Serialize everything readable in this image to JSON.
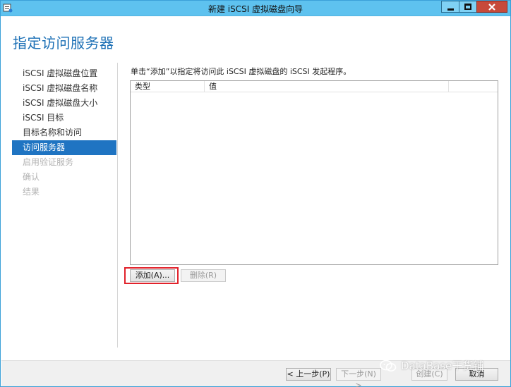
{
  "window": {
    "title": "新建 iSCSI 虚拟磁盘向导",
    "heading": "指定访问服务器"
  },
  "colors": {
    "titlebar": "#5ec2ef",
    "heading": "#1b6fb5",
    "nav_active": "#1f74c2",
    "highlight": "#e1222b"
  },
  "icons": {
    "app": "wizard-app-icon",
    "minimize": "minimize-icon",
    "maximize": "maximize-icon",
    "close": "close-icon",
    "watermark": "wechat-icon"
  },
  "nav": {
    "items": [
      {
        "label": "iSCSI 虚拟磁盘位置",
        "state": "normal"
      },
      {
        "label": "iSCSI 虚拟磁盘名称",
        "state": "normal"
      },
      {
        "label": "iSCSI 虚拟磁盘大小",
        "state": "normal"
      },
      {
        "label": "iSCSI 目标",
        "state": "normal"
      },
      {
        "label": "目标名称和访问",
        "state": "normal"
      },
      {
        "label": "访问服务器",
        "state": "active"
      },
      {
        "label": "启用验证服务",
        "state": "disabled"
      },
      {
        "label": "确认",
        "state": "disabled"
      },
      {
        "label": "结果",
        "state": "disabled"
      }
    ]
  },
  "main": {
    "instruction": "单击“添加”以指定将访问此 iSCSI 虚拟磁盘的 iSCSI 发起程序。",
    "columns": [
      "类型",
      "值",
      ""
    ],
    "add_button": "添加(A)...",
    "remove_button": "删除(R)"
  },
  "footer": {
    "prev_button": "< 上一步(P)",
    "next_button": "下一步(N) >",
    "create_button": "创建(C)",
    "cancel_button": "取消"
  },
  "watermark": {
    "text": "DataBase干货铺"
  }
}
